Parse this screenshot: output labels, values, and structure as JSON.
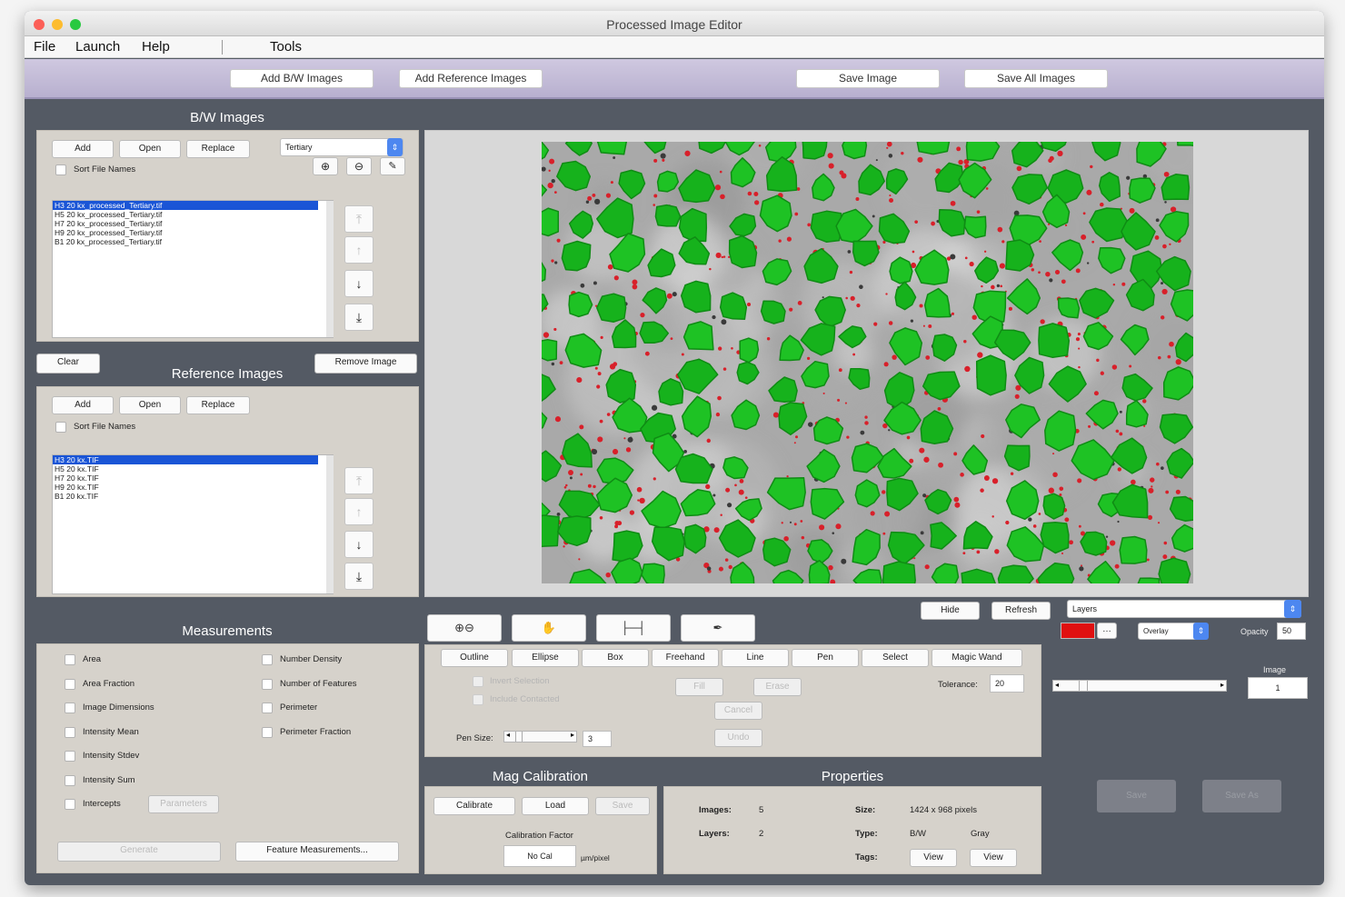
{
  "window": {
    "title": "Processed Image Editor"
  },
  "menu": {
    "file": "File",
    "launch": "Launch",
    "help": "Help",
    "tools": "Tools"
  },
  "toolbar": {
    "add_bw": "Add B/W Images",
    "add_ref": "Add Reference Images",
    "save_image": "Save Image",
    "save_all": "Save All Images"
  },
  "bw": {
    "title": "B/W Images",
    "add": "Add",
    "open": "Open",
    "replace": "Replace",
    "dropdown": "Tertiary",
    "sort": "Sort File Names",
    "files": [
      "H3 20 kx_processed_Tertiary.tif",
      "H5 20 kx_processed_Tertiary.tif",
      "H7 20 kx_processed_Tertiary.tif",
      "H9 20 kx_processed_Tertiary.tif",
      "B1 20 kx_processed_Tertiary.tif"
    ]
  },
  "middle": {
    "clear": "Clear",
    "remove_image": "Remove Image"
  },
  "ref": {
    "title": "Reference Images",
    "add": "Add",
    "open": "Open",
    "replace": "Replace",
    "sort": "Sort File Names",
    "files": [
      "H3 20 kx.TIF",
      "H5 20 kx.TIF",
      "H7 20 kx.TIF",
      "H9 20 kx.TIF",
      "B1 20 kx.TIF"
    ]
  },
  "measurements": {
    "title": "Measurements",
    "left": [
      "Area",
      "Area Fraction",
      "Image Dimensions",
      "Intensity Mean",
      "Intensity Stdev",
      "Intensity Sum",
      "Intercepts"
    ],
    "right": [
      "Number Density",
      "Number of Features",
      "Perimeter",
      "Perimeter Fraction"
    ],
    "parameters": "Parameters",
    "generate": "Generate",
    "feature": "Feature Measurements..."
  },
  "view": {
    "hide": "Hide",
    "refresh": "Refresh",
    "layers": "Layers",
    "overlay": "Overlay",
    "opacity_label": "Opacity",
    "opacity": "50",
    "image_label": "Image",
    "image": "1",
    "save": "Save",
    "save_as": "Save As",
    "color": "#e01010"
  },
  "tools": {
    "tabs": [
      "Outline",
      "Ellipse",
      "Box",
      "Freehand",
      "Line",
      "Pen",
      "Select",
      "Magic Wand"
    ],
    "invert": "Invert Selection",
    "include": "Include Contacted",
    "fill": "Fill",
    "erase": "Erase",
    "cancel": "Cancel",
    "undo": "Undo",
    "tolerance_label": "Tolerance:",
    "tolerance": "20",
    "pen_label": "Pen Size:",
    "pen": "3"
  },
  "mag": {
    "title": "Mag Calibration",
    "calibrate": "Calibrate",
    "load": "Load",
    "save": "Save",
    "factor_label": "Calibration Factor",
    "factor": "No Cal",
    "unit": "µm/pixel"
  },
  "props": {
    "title": "Properties",
    "images_label": "Images:",
    "images": "5",
    "layers_label": "Layers:",
    "layers": "2",
    "size_label": "Size:",
    "size": "1424 x 968 pixels",
    "type_label": "Type:",
    "type1": "B/W",
    "type2": "Gray",
    "tags_label": "Tags:",
    "view1": "View",
    "view2": "View"
  }
}
